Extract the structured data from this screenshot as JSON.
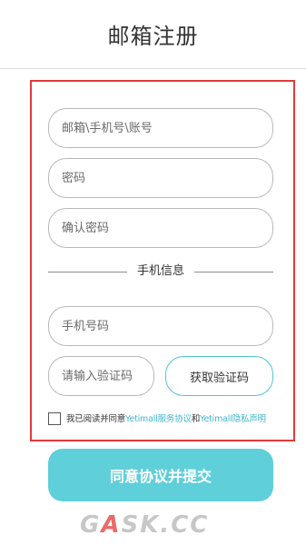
{
  "header": {
    "title": "邮箱注册"
  },
  "form": {
    "account_placeholder": "邮箱\\手机号\\账号",
    "password_placeholder": "密码",
    "confirm_placeholder": "确认密码",
    "section_label": "手机信息",
    "phone_placeholder": "手机号码",
    "code_placeholder": "请输入验证码",
    "get_code_label": "获取验证码"
  },
  "agreement": {
    "prefix": "我已阅读并同意",
    "service_link": "Yetimall服务协议",
    "joiner": "和",
    "privacy_link": "Yetimall隐私声明"
  },
  "submit": {
    "label": "同意协议并提交"
  },
  "watermark": {
    "part1": "G",
    "part2": "A",
    "part3": "SK.CC"
  },
  "colors": {
    "accent": "#5fcfd9",
    "link": "#3fb6cc",
    "highlight_frame": "#e13a3a"
  }
}
